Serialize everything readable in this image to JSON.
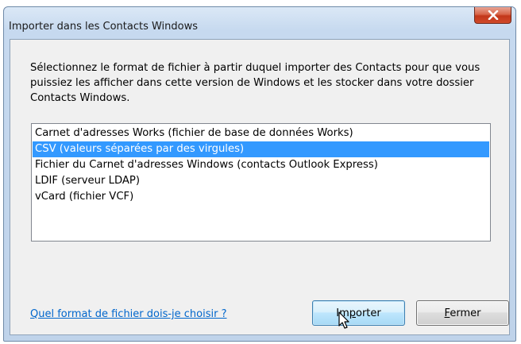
{
  "window": {
    "title": "Importer dans les Contacts Windows",
    "close_label": "X"
  },
  "description": "Sélectionnez le format de fichier à partir duquel importer des Contacts pour que vous puissiez les afficher dans cette version de Windows et les stocker dans votre dossier Contacts Windows.",
  "formats": [
    {
      "label": "Carnet d'adresses Works (fichier de base de données Works)",
      "selected": false
    },
    {
      "label": "CSV (valeurs séparées par des virgules)",
      "selected": true
    },
    {
      "label": "Fichier du Carnet d'adresses Windows (contacts Outlook Express)",
      "selected": false
    },
    {
      "label": "LDIF (serveur LDAP)",
      "selected": false
    },
    {
      "label": "vCard (fichier VCF)",
      "selected": false
    }
  ],
  "help_link": "Quel format de fichier dois-je choisir ?",
  "buttons": {
    "import": {
      "before": "Im",
      "mnemonic": "p",
      "after": "orter"
    },
    "close": {
      "before": "",
      "mnemonic": "F",
      "after": "ermer"
    }
  },
  "colors": {
    "selection": "#3399ff",
    "link": "#0066cc",
    "close_button": "#c2371a"
  }
}
